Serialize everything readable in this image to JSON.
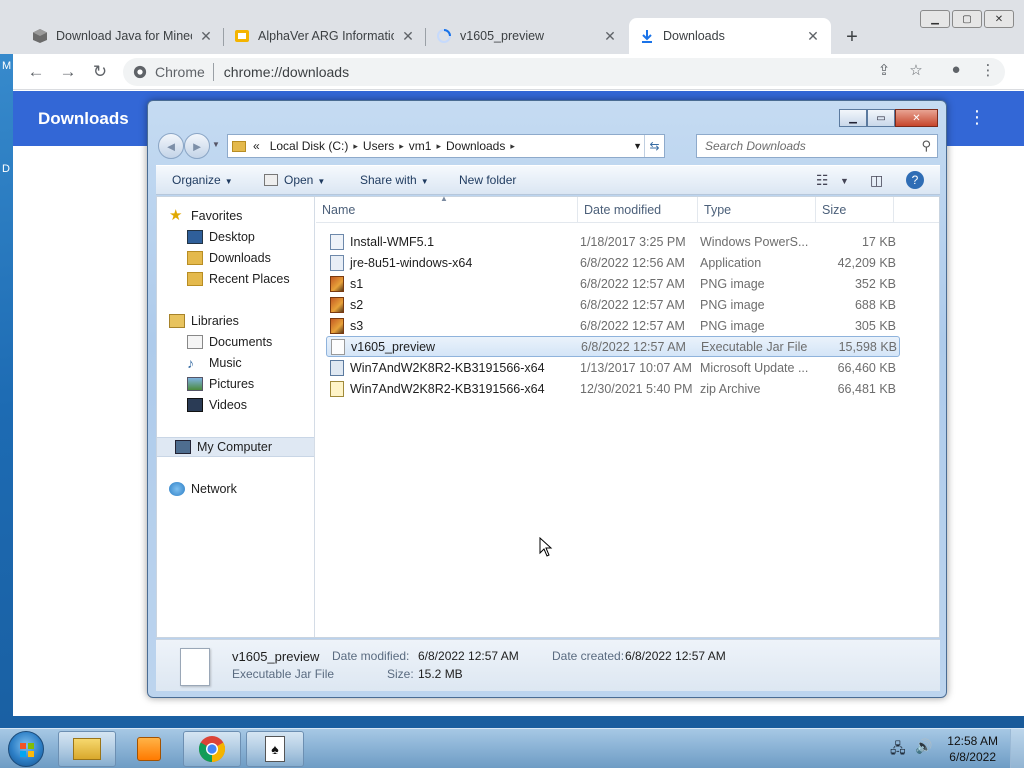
{
  "desktop": {
    "glyph_top": "M",
    "glyph_mid": "D"
  },
  "chrome": {
    "tabs": [
      {
        "title": "Download Java for Minecraft",
        "close": "✕"
      },
      {
        "title": "AlphaVer ARG Information",
        "close": "✕"
      },
      {
        "title": "v1605_preview",
        "close": "✕"
      },
      {
        "title": "Downloads",
        "close": "✕"
      }
    ],
    "new_tab": "+",
    "omnibox_label": "Chrome",
    "url": "chrome://downloads",
    "page_title": "Downloads",
    "menu_icon": "⋮"
  },
  "explorer": {
    "breadcrumb": [
      "«",
      "Local Disk (C:)",
      "Users",
      "vm1",
      "Downloads"
    ],
    "search_placeholder": "Search Downloads",
    "toolbar": {
      "organize": "Organize",
      "open": "Open",
      "share_with": "Share with",
      "new_folder": "New folder"
    },
    "nav": {
      "favorites": "Favorites",
      "desktop": "Desktop",
      "downloads": "Downloads",
      "recent": "Recent Places",
      "libraries": "Libraries",
      "documents": "Documents",
      "music": "Music",
      "pictures": "Pictures",
      "videos": "Videos",
      "computer": "My Computer",
      "network": "Network"
    },
    "columns": {
      "name": "Name",
      "date": "Date modified",
      "type": "Type",
      "size": "Size"
    },
    "files": [
      {
        "name": "Install-WMF5.1",
        "date": "1/18/2017 3:25 PM",
        "type": "Windows PowerS...",
        "size": "17 KB",
        "icon": "ps1"
      },
      {
        "name": "jre-8u51-windows-x64",
        "date": "6/8/2022 12:56 AM",
        "type": "Application",
        "size": "42,209 KB",
        "icon": "exe"
      },
      {
        "name": "s1",
        "date": "6/8/2022 12:57 AM",
        "type": "PNG image",
        "size": "352 KB",
        "icon": "png"
      },
      {
        "name": "s2",
        "date": "6/8/2022 12:57 AM",
        "type": "PNG image",
        "size": "688 KB",
        "icon": "png"
      },
      {
        "name": "s3",
        "date": "6/8/2022 12:57 AM",
        "type": "PNG image",
        "size": "305 KB",
        "icon": "png"
      },
      {
        "name": "v1605_preview",
        "date": "6/8/2022 12:57 AM",
        "type": "Executable Jar File",
        "size": "15,598 KB",
        "icon": "jar"
      },
      {
        "name": "Win7AndW2K8R2-KB3191566-x64",
        "date": "1/13/2017 10:07 AM",
        "type": "Microsoft Update ...",
        "size": "66,460 KB",
        "icon": "msu"
      },
      {
        "name": "Win7AndW2K8R2-KB3191566-x64",
        "date": "12/30/2021 5:40 PM",
        "type": "zip Archive",
        "size": "66,481 KB",
        "icon": "zip"
      }
    ],
    "details": {
      "name": "v1605_preview",
      "type": "Executable Jar File",
      "modified_label": "Date modified:",
      "modified": "6/8/2022 12:57 AM",
      "created_label": "Date created:",
      "created": "6/8/2022 12:57 AM",
      "size_label": "Size:",
      "size": "15.2 MB"
    }
  },
  "taskbar": {
    "time": "12:58 AM",
    "date": "6/8/2022"
  },
  "colors": {
    "chrome_header": "#3367d6",
    "selection": "#d4e5f7"
  }
}
